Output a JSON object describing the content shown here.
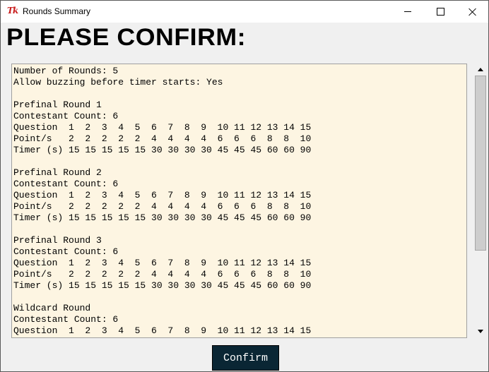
{
  "window": {
    "title": "Rounds Summary",
    "icon_label": "Tk"
  },
  "heading": "PLEASE CONFIRM:",
  "summary_lines": [
    "Number of Rounds: 5",
    "Allow buzzing before timer starts: Yes",
    "",
    "Prefinal Round 1",
    "Contestant Count: 6",
    "Question  1  2  3  4  5  6  7  8  9  10 11 12 13 14 15",
    "Point/s   2  2  2  2  2  4  4  4  4  6  6  6  8  8  10",
    "Timer (s) 15 15 15 15 15 30 30 30 30 45 45 45 60 60 90",
    "",
    "Prefinal Round 2",
    "Contestant Count: 6",
    "Question  1  2  3  4  5  6  7  8  9  10 11 12 13 14 15",
    "Point/s   2  2  2  2  2  4  4  4  4  6  6  6  8  8  10",
    "Timer (s) 15 15 15 15 15 30 30 30 30 45 45 45 60 60 90",
    "",
    "Prefinal Round 3",
    "Contestant Count: 6",
    "Question  1  2  3  4  5  6  7  8  9  10 11 12 13 14 15",
    "Point/s   2  2  2  2  2  4  4  4  4  6  6  6  8  8  10",
    "Timer (s) 15 15 15 15 15 30 30 30 30 45 45 45 60 60 90",
    "",
    "Wildcard Round",
    "Contestant Count: 6",
    "Question  1  2  3  4  5  6  7  8  9  10 11 12 13 14 15"
  ],
  "confirm_label": "Confirm",
  "icons": {
    "app": "tk-feather-icon",
    "minimize": "minimize-icon",
    "maximize": "maximize-icon",
    "close": "close-icon",
    "scroll_up": "scroll-up-arrow-icon",
    "scroll_down": "scroll-down-arrow-icon"
  },
  "colors": {
    "text_area_bg": "#fdf5e2",
    "confirm_button_bg": "#0a2634",
    "confirm_button_text": "#ffffff",
    "app_icon": "#c81e1e"
  }
}
